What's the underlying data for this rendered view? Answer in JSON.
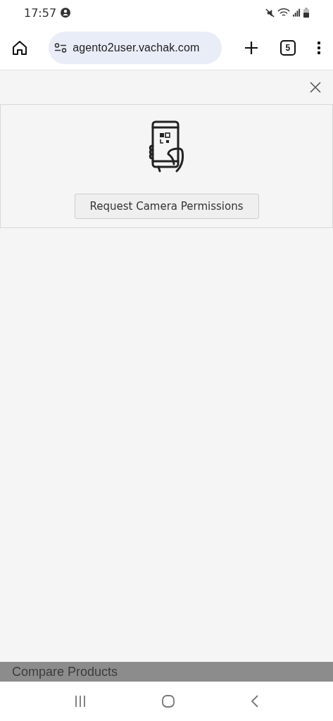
{
  "status_bar": {
    "time": "17:57"
  },
  "browser": {
    "url": "agento2user.vachak.com",
    "tab_count": "5"
  },
  "modal": {
    "button": "Request Camera Permissions"
  },
  "background_page": {
    "text": "Compare Products"
  }
}
